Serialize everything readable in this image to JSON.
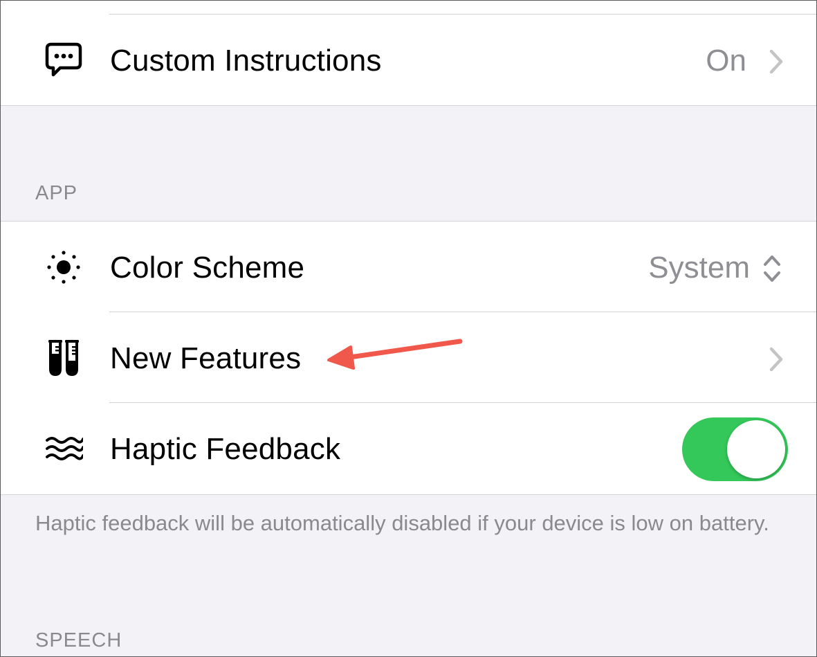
{
  "account_group": {
    "custom_instructions": {
      "label": "Custom Instructions",
      "value": "On",
      "icon": "speech-bubble-icon"
    }
  },
  "app_section": {
    "header": "APP",
    "color_scheme": {
      "label": "Color Scheme",
      "value": "System",
      "icon": "sun-icon"
    },
    "new_features": {
      "label": "New Features",
      "icon": "test-tubes-icon"
    },
    "haptic_feedback": {
      "label": "Haptic Feedback",
      "icon": "waves-icon",
      "enabled": true
    },
    "footer": "Haptic feedback will be automatically disabled if your device is low on battery."
  },
  "speech_section": {
    "header": "SPEECH"
  },
  "colors": {
    "toggle_on": "#34c759",
    "annotation_arrow": "#f0584c",
    "secondary_text": "#8e8e93",
    "grouped_background": "#f2f2f7"
  }
}
